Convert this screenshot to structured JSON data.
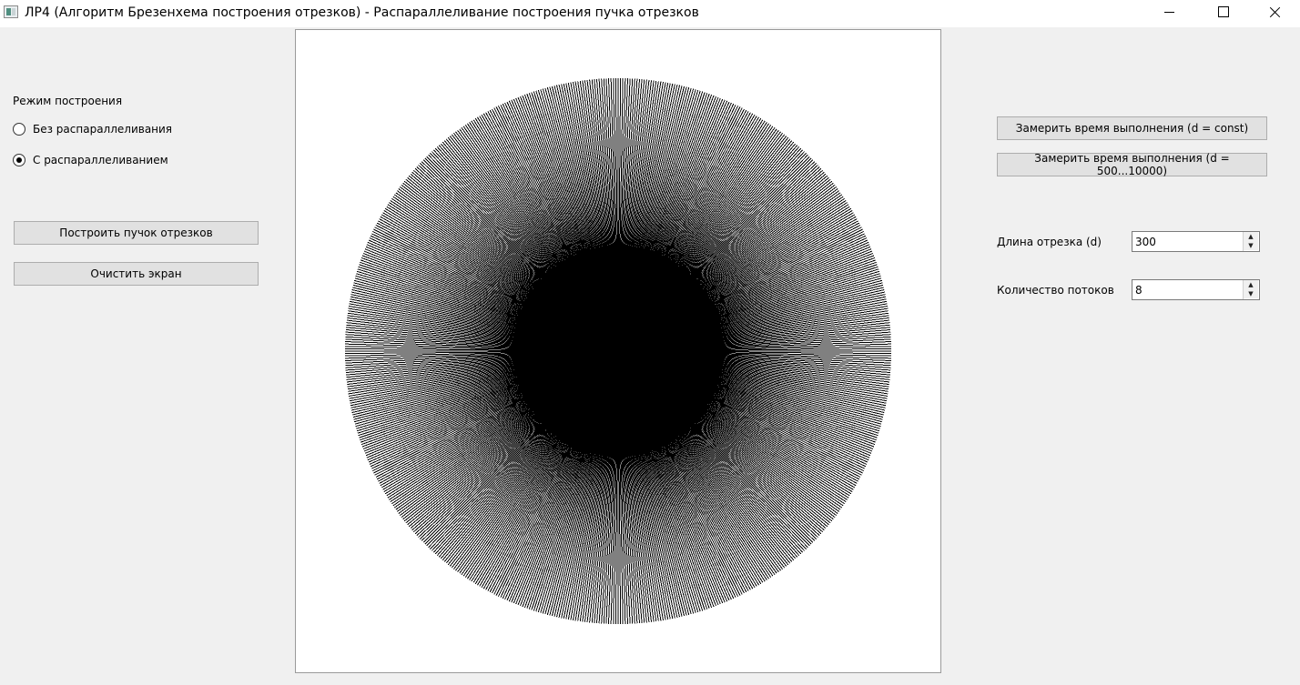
{
  "window": {
    "title": "ЛР4 (Алгоритм Брезенхема построения отрезков) - Распараллеливание построения пучка отрезков"
  },
  "left_panel": {
    "mode_label": "Режим построения",
    "modes": [
      {
        "label": "Без распараллеливания",
        "checked": false
      },
      {
        "label": "С распараллеливанием",
        "checked": true
      }
    ],
    "build_button": "Построить пучок отрезков",
    "clear_button": "Очистить экран"
  },
  "right_panel": {
    "measure_const_button": "Замерить время выполнения (d = const)",
    "measure_range_button": "Замерить время выполнения (d = 500...10000)",
    "length_label": "Длина отрезка (d)",
    "length_value": "300",
    "threads_label": "Количество потоков",
    "threads_value": "8"
  },
  "canvas": {
    "line_color": "#000000",
    "background": "#ffffff",
    "segment_length": 300
  }
}
